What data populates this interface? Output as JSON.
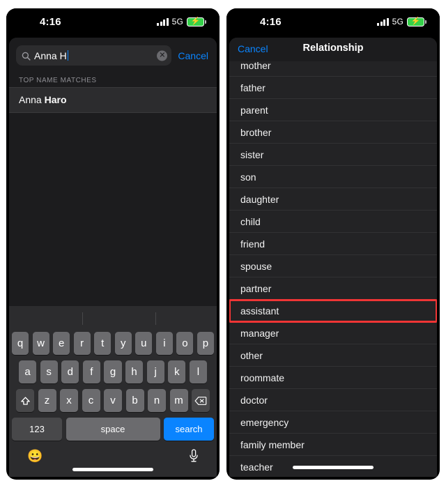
{
  "status_bar": {
    "time": "4:16",
    "network": "5G",
    "signal_icon": "cellular-signal-icon",
    "battery_icon": "battery-charging-icon",
    "battery_color": "#35d04a"
  },
  "accent_blue": "#0a84ff",
  "highlight_color": "#ef3535",
  "left_panel": {
    "search": {
      "icon": "search-icon",
      "value": "Anna H",
      "placeholder": "Search",
      "clear_icon": "clear-text-icon",
      "cancel_label": "Cancel"
    },
    "section_header": "TOP NAME MATCHES",
    "results": [
      {
        "prefix": "Anna ",
        "match": "Haro"
      }
    ],
    "keyboard": {
      "predictive_suggestions": [
        "",
        "",
        ""
      ],
      "row1": [
        "q",
        "w",
        "e",
        "r",
        "t",
        "y",
        "u",
        "i",
        "o",
        "p"
      ],
      "row2": [
        "a",
        "s",
        "d",
        "f",
        "g",
        "h",
        "j",
        "k",
        "l"
      ],
      "row3": [
        "z",
        "x",
        "c",
        "v",
        "b",
        "n",
        "m"
      ],
      "shift_icon": "shift-arrow-icon",
      "backspace_icon": "backspace-delete-icon",
      "numbers_label": "123",
      "space_label": "space",
      "return_label": "search",
      "emoji_icon": "emoji-smiley-icon",
      "dictation_icon": "microphone-icon",
      "home_indicator": "home-indicator"
    }
  },
  "right_panel": {
    "nav": {
      "cancel_label": "Cancel",
      "title": "Relationship"
    },
    "items": [
      {
        "label": "mother",
        "highlighted": false
      },
      {
        "label": "father",
        "highlighted": false
      },
      {
        "label": "parent",
        "highlighted": false
      },
      {
        "label": "brother",
        "highlighted": false
      },
      {
        "label": "sister",
        "highlighted": false
      },
      {
        "label": "son",
        "highlighted": false
      },
      {
        "label": "daughter",
        "highlighted": false
      },
      {
        "label": "child",
        "highlighted": false
      },
      {
        "label": "friend",
        "highlighted": false
      },
      {
        "label": "spouse",
        "highlighted": false
      },
      {
        "label": "partner",
        "highlighted": false
      },
      {
        "label": "assistant",
        "highlighted": true
      },
      {
        "label": "manager",
        "highlighted": false
      },
      {
        "label": "other",
        "highlighted": false
      },
      {
        "label": "roommate",
        "highlighted": false
      },
      {
        "label": "doctor",
        "highlighted": false
      },
      {
        "label": "emergency",
        "highlighted": false
      },
      {
        "label": "family member",
        "highlighted": false
      },
      {
        "label": "teacher",
        "highlighted": false
      }
    ],
    "home_indicator": "home-indicator"
  }
}
